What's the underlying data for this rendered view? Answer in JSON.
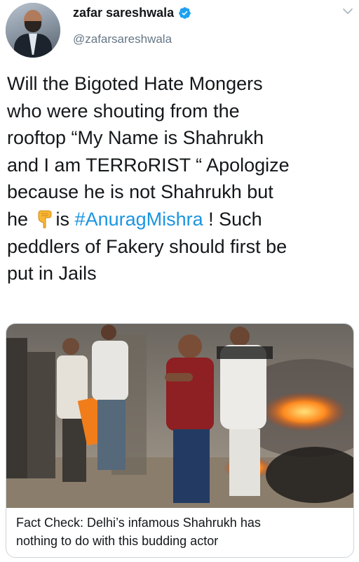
{
  "author": {
    "display_name": "zafar sareshwala",
    "handle": "@zafarsareshwala",
    "verified_icon": "verified-badge-icon",
    "avatar_icon": "profile-photo"
  },
  "tweet": {
    "lines": [
      "Will the Bigoted Hate Mongers",
      "who were shouting from the",
      "rooftop “My Name is Shahrukh",
      "and I am TERRoRIST “ Apologize",
      "because he is not Shahrukh but"
    ],
    "line6_before": "he ",
    "line6_emoji": "👇",
    "line6_mid": "is ",
    "hashtag": "#AnuragMishra",
    "line6_after": " ! Such",
    "line7": "peddlers of Fakery should first be",
    "line8": "put in Jails"
  },
  "card": {
    "image_icon": "news-photo",
    "caption_line1": "Fact Check: Delhi’s infamous Shahrukh has",
    "caption_line2": "nothing to do with this budding actor"
  },
  "colors": {
    "link": "#1b95e0",
    "handle": "#657786",
    "text": "#14171a",
    "border": "#ccd6dd"
  }
}
